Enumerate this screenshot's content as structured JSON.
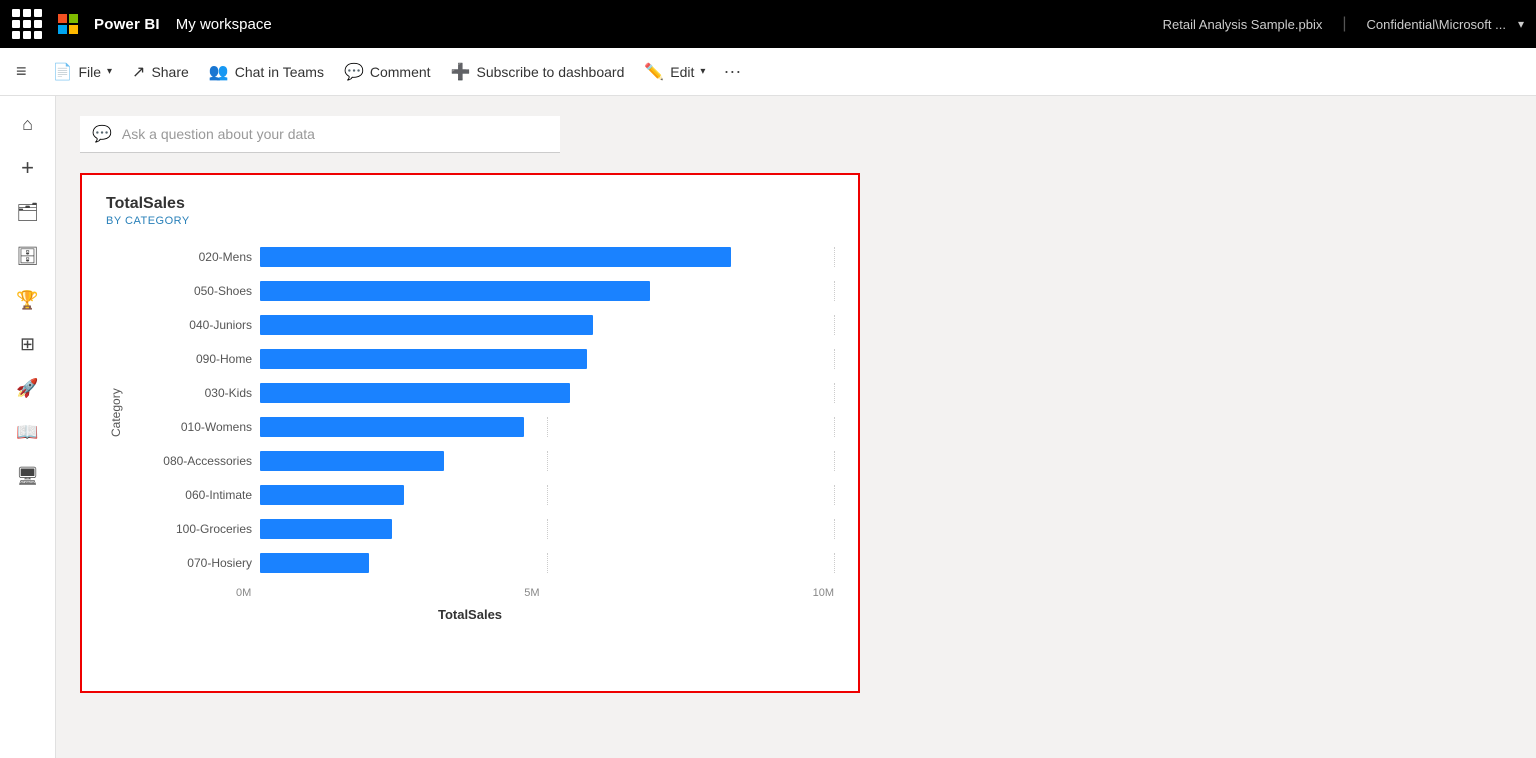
{
  "topbar": {
    "dots_label": "App launcher",
    "ms_logo_label": "Microsoft logo",
    "product": "Power BI",
    "workspace": "My workspace",
    "file_title": "Retail Analysis Sample.pbix",
    "confidential": "Confidential\\Microsoft ...",
    "chevron": "▾"
  },
  "toolbar": {
    "hamburger": "≡",
    "file_label": "File",
    "share_label": "Share",
    "chat_in_teams_label": "Chat in Teams",
    "comment_label": "Comment",
    "subscribe_label": "Subscribe to dashboard",
    "edit_label": "Edit",
    "more_label": "···"
  },
  "sidebar": {
    "items": [
      {
        "icon": "⌂",
        "name": "home"
      },
      {
        "icon": "+",
        "name": "create"
      },
      {
        "icon": "🗂",
        "name": "browse"
      },
      {
        "icon": "🗄",
        "name": "data-hub"
      },
      {
        "icon": "🏆",
        "name": "goals"
      },
      {
        "icon": "⊞",
        "name": "apps"
      },
      {
        "icon": "🚀",
        "name": "learn"
      },
      {
        "icon": "📖",
        "name": "docs"
      },
      {
        "icon": "🖥",
        "name": "workspaces"
      }
    ]
  },
  "qa": {
    "placeholder": "Ask a question about your data",
    "icon": "💬"
  },
  "chart": {
    "title": "TotalSales",
    "subtitle": "BY CATEGORY",
    "y_axis_label": "Category",
    "x_axis_label": "TotalSales",
    "x_ticks": [
      "0M",
      "5M",
      "10M"
    ],
    "max_value": 10000000,
    "bars": [
      {
        "label": "020-Mens",
        "value": 8200000
      },
      {
        "label": "050-Shoes",
        "value": 6800000
      },
      {
        "label": "040-Juniors",
        "value": 5800000
      },
      {
        "label": "090-Home",
        "value": 5700000
      },
      {
        "label": "030-Kids",
        "value": 5400000
      },
      {
        "label": "010-Womens",
        "value": 4600000
      },
      {
        "label": "080-Accessories",
        "value": 3200000
      },
      {
        "label": "060-Intimate",
        "value": 2500000
      },
      {
        "label": "100-Groceries",
        "value": 2300000
      },
      {
        "label": "070-Hosiery",
        "value": 1900000
      }
    ]
  }
}
